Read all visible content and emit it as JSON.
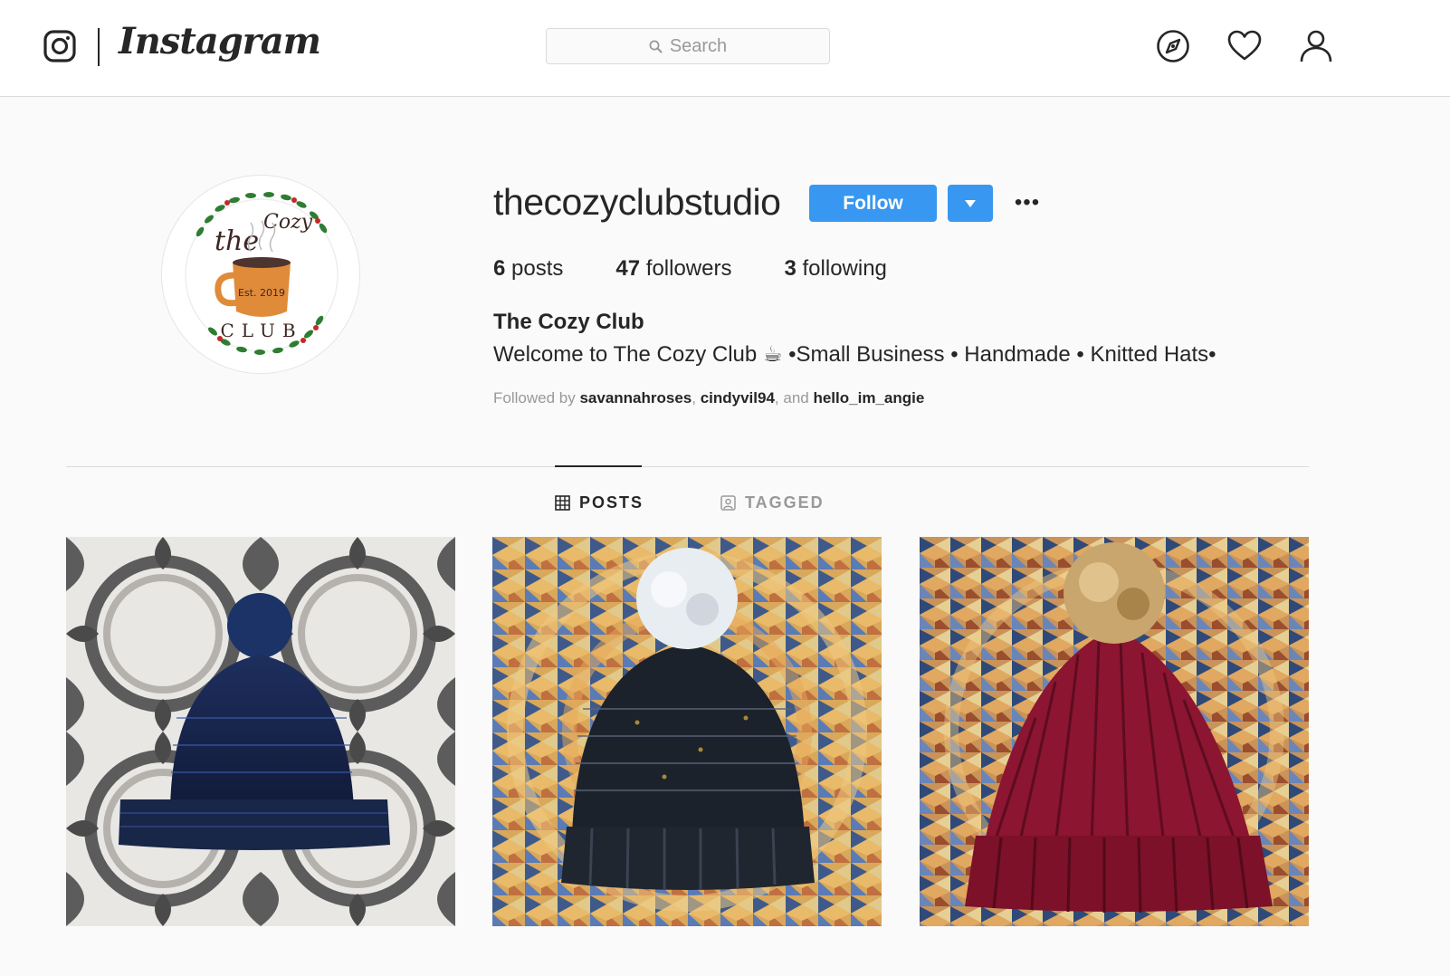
{
  "header": {
    "logo_icon": "instagram-camera-icon",
    "wordmark": "Instagram",
    "search": {
      "placeholder": "Search",
      "icon": "search-icon"
    },
    "nav_icons": [
      "explore-compass-icon",
      "activity-heart-icon",
      "profile-person-icon"
    ]
  },
  "profile": {
    "username": "thecozyclubstudio",
    "follow_label": "Follow",
    "more_label": "•••",
    "stats": {
      "posts_count": "6",
      "posts_label": "posts",
      "followers_count": "47",
      "followers_label": "followers",
      "following_count": "3",
      "following_label": "following"
    },
    "full_name": "The Cozy Club",
    "bio": "Welcome to The Cozy Club ☕ •Small Business • Handmade • Knitted Hats•",
    "followed_by": {
      "prefix": "Followed by",
      "users": [
        "savannahroses",
        "cindyvil94",
        "hello_im_angie"
      ],
      "sep1": ", ",
      "sep2": ", and "
    },
    "avatar_text": {
      "line1": "the",
      "line2": "Cozy",
      "est": "Est. 2019",
      "club": "CLUB"
    }
  },
  "tabs": [
    {
      "label": "POSTS",
      "icon": "grid-icon",
      "active": true
    },
    {
      "label": "TAGGED",
      "icon": "tagged-person-icon",
      "active": false
    }
  ],
  "posts": [
    {
      "subject": "navy knitted beanie with pom-pom on patterned tile"
    },
    {
      "subject": "charcoal speckled knitted beanie with white faux-fur pom on braided rug"
    },
    {
      "subject": "burgundy ribbed knitted beanie with tan faux-fur pom on braided rug"
    }
  ],
  "colors": {
    "accent": "#3897f0",
    "text": "#262626",
    "muted": "#999999",
    "border": "#dbdbdb",
    "background": "#fafafa"
  }
}
